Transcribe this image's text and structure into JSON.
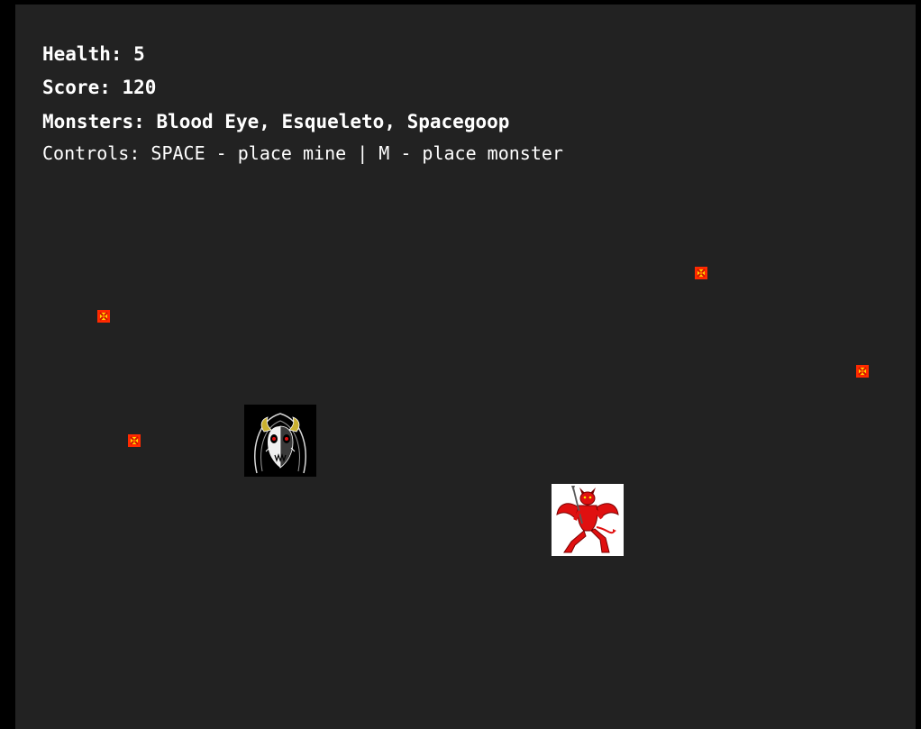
{
  "hud": {
    "health_label": "Health:",
    "health_value": "5",
    "score_label": "Score:",
    "score_value": "120",
    "monsters_label": "Monsters:",
    "monsters_list": "Blood Eye, Esqueleto, Spacegoop",
    "controls_text": "Controls: SPACE - place mine | M - place monster"
  },
  "colors": {
    "page_background": "#000000",
    "game_background": "#222222",
    "hud_text": "#ffffff",
    "mine_outer": "#ff2a00",
    "mine_inner": "#ffd400",
    "demon_red": "#e01010"
  },
  "entities": {
    "mines": [
      {
        "name": "mine",
        "icon": "mine-icon"
      },
      {
        "name": "mine",
        "icon": "mine-icon"
      },
      {
        "name": "mine",
        "icon": "mine-icon"
      },
      {
        "name": "mine",
        "icon": "mine-icon"
      }
    ],
    "monsters": [
      {
        "name": "monster-skull-mask",
        "icon": "horned-skull-mask-icon"
      },
      {
        "name": "monster-red-demon",
        "icon": "red-demon-icon"
      }
    ]
  }
}
